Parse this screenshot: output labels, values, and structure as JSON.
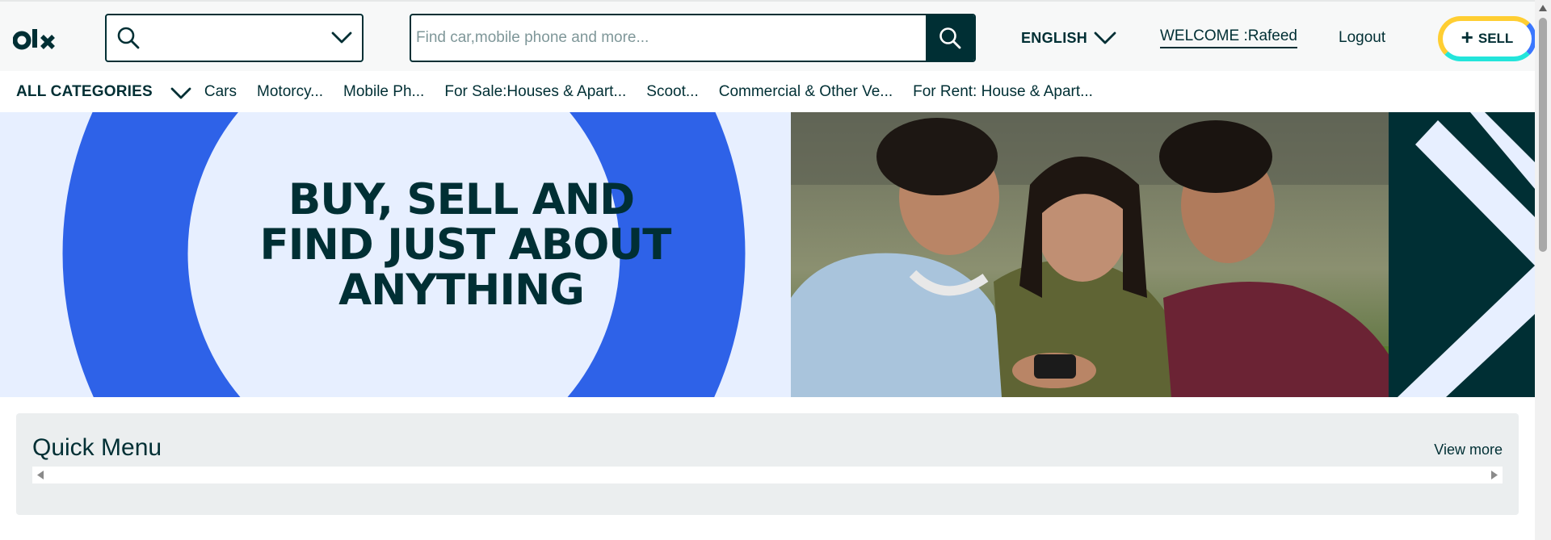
{
  "brand": {
    "name": "olx"
  },
  "header": {
    "location_placeholder": "",
    "search_placeholder": "Find car,mobile phone and more...",
    "language": "ENGLISH",
    "welcome": "WELCOME :Rafeed",
    "logout": "Logout",
    "sell_label": "SELL",
    "sell_plus": "+"
  },
  "categories": {
    "all_label": "ALL CATEGORIES",
    "items": [
      "Cars",
      "Motorcy...",
      "Mobile Ph...",
      "For Sale:Houses & Apart...",
      "Scoot...",
      "Commercial & Other Ve...",
      "For Rent: House & Apart..."
    ]
  },
  "banner": {
    "line1": "BUY, SELL AND",
    "line2": "FIND JUST ABOUT",
    "line3": "ANYTHING"
  },
  "quick_menu": {
    "title": "Quick Menu",
    "view_more": "View more"
  },
  "colors": {
    "brand_dark": "#002f34",
    "banner_blue": "#2e62e8",
    "banner_light": "#e7efff",
    "sell_yellow": "#ffce32",
    "sell_blue": "#3a77ff",
    "sell_teal": "#23e5db"
  },
  "icons": {
    "location": "search-icon",
    "dropdown": "chevron-down-icon",
    "search": "search-icon",
    "language": "chevron-down-icon",
    "sell": "plus-icon"
  }
}
